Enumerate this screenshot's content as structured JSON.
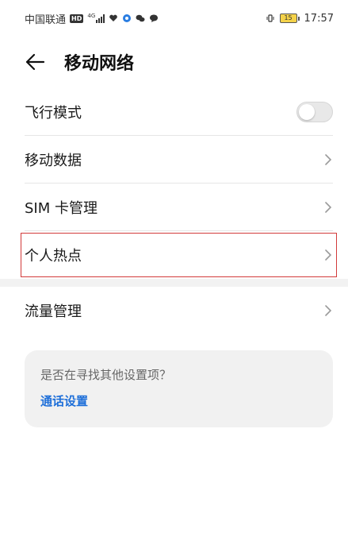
{
  "status_bar": {
    "carrier": "中国联通",
    "hd": "HD",
    "signal": "4G",
    "battery_level": "15",
    "time": "17:57"
  },
  "header": {
    "title": "移动网络"
  },
  "settings": {
    "items": [
      {
        "label": "飞行模式",
        "type": "toggle",
        "on": false
      },
      {
        "label": "移动数据",
        "type": "chevron"
      },
      {
        "label": "SIM 卡管理",
        "type": "chevron"
      },
      {
        "label": "个人热点",
        "type": "chevron",
        "highlighted": true
      }
    ],
    "items2": [
      {
        "label": "流量管理",
        "type": "chevron"
      }
    ]
  },
  "suggestion": {
    "question": "是否在寻找其他设置项？",
    "link": "通话设置"
  },
  "colors": {
    "accent": "#1e6fd9",
    "highlight_border": "#d23a3a"
  }
}
